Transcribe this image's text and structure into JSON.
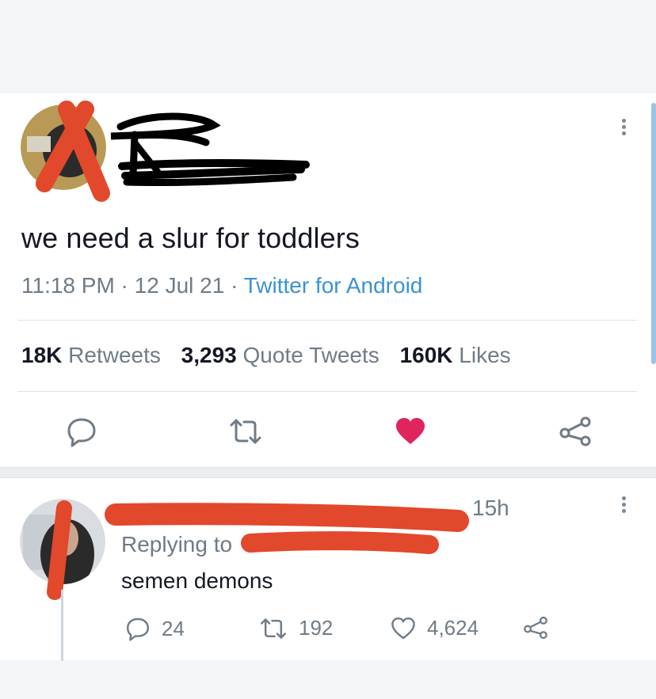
{
  "tweet": {
    "text": "we need a slur for toddlers",
    "time": "11:18 PM",
    "date": "12 Jul 21",
    "separator": " · ",
    "source": "Twitter for Android"
  },
  "stats": {
    "retweets_count": "18K",
    "retweets_label": "Retweets",
    "quotes_count": "3,293",
    "quotes_label": "Quote Tweets",
    "likes_count": "160K",
    "likes_label": "Likes"
  },
  "actions": {
    "icons": [
      "reply-icon",
      "retweet-icon",
      "like-icon",
      "share-icon"
    ],
    "like_color": "#e0245e"
  },
  "reply": {
    "time": "15h",
    "replying_prefix": "Replying to",
    "text": "semen demons",
    "reply_count": "24",
    "retweet_count": "192",
    "like_count": "4,624"
  },
  "colors": {
    "redaction": "#e2482b",
    "link": "#3a92d3",
    "muted": "#6f7b86"
  }
}
